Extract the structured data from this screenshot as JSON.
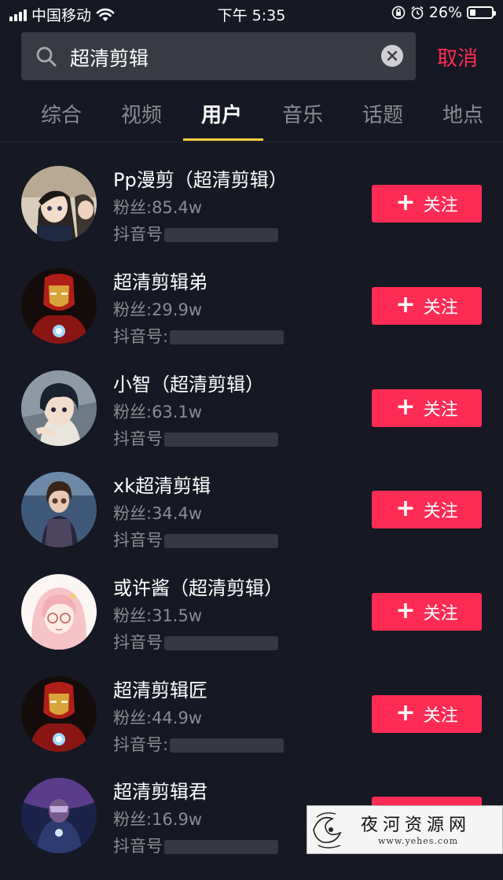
{
  "status_bar": {
    "carrier": "中国移动",
    "time": "下午 5:35",
    "battery": "26%",
    "battery_level": 0.26
  },
  "search": {
    "query": "超清剪辑",
    "cancel_label": "取消"
  },
  "tabs": [
    {
      "label": "综合",
      "active": false
    },
    {
      "label": "视频",
      "active": false
    },
    {
      "label": "用户",
      "active": true
    },
    {
      "label": "音乐",
      "active": false
    },
    {
      "label": "话题",
      "active": false
    },
    {
      "label": "地点",
      "active": false
    }
  ],
  "users": [
    {
      "name": "Pp漫剪（超清剪辑）",
      "fans": "粉丝:85.4w",
      "id_label": "抖音号",
      "follow": "关注",
      "avatar": "anime-boy"
    },
    {
      "name": "超清剪辑弟",
      "fans": "粉丝:29.9w",
      "id_label": "抖音号:",
      "follow": "关注",
      "avatar": "iron-man"
    },
    {
      "name": "小智（超清剪辑）",
      "fans": "粉丝:63.1w",
      "id_label": "抖音号",
      "follow": "关注",
      "avatar": "anime-dark-hair"
    },
    {
      "name": "xk超清剪辑",
      "fans": "粉丝:34.4w",
      "id_label": "抖音号",
      "follow": "关注",
      "avatar": "cyborg-girl"
    },
    {
      "name": "或许酱（超清剪辑）",
      "fans": "粉丝:31.5w",
      "id_label": "抖音号",
      "follow": "关注",
      "avatar": "anime-pink-hair"
    },
    {
      "name": "超清剪辑匠",
      "fans": "粉丝:44.9w",
      "id_label": "抖音号:",
      "follow": "关注",
      "avatar": "iron-man"
    },
    {
      "name": "超清剪辑君",
      "fans": "粉丝:16.9w",
      "id_label": "抖音号",
      "follow": "关注",
      "avatar": "space-hero"
    }
  ],
  "watermark": {
    "title": "夜河资源网",
    "url": "www.yehes.com"
  },
  "colors": {
    "background": "#161823",
    "accent": "#fe2c55",
    "tab_indicator": "#facf3c"
  }
}
